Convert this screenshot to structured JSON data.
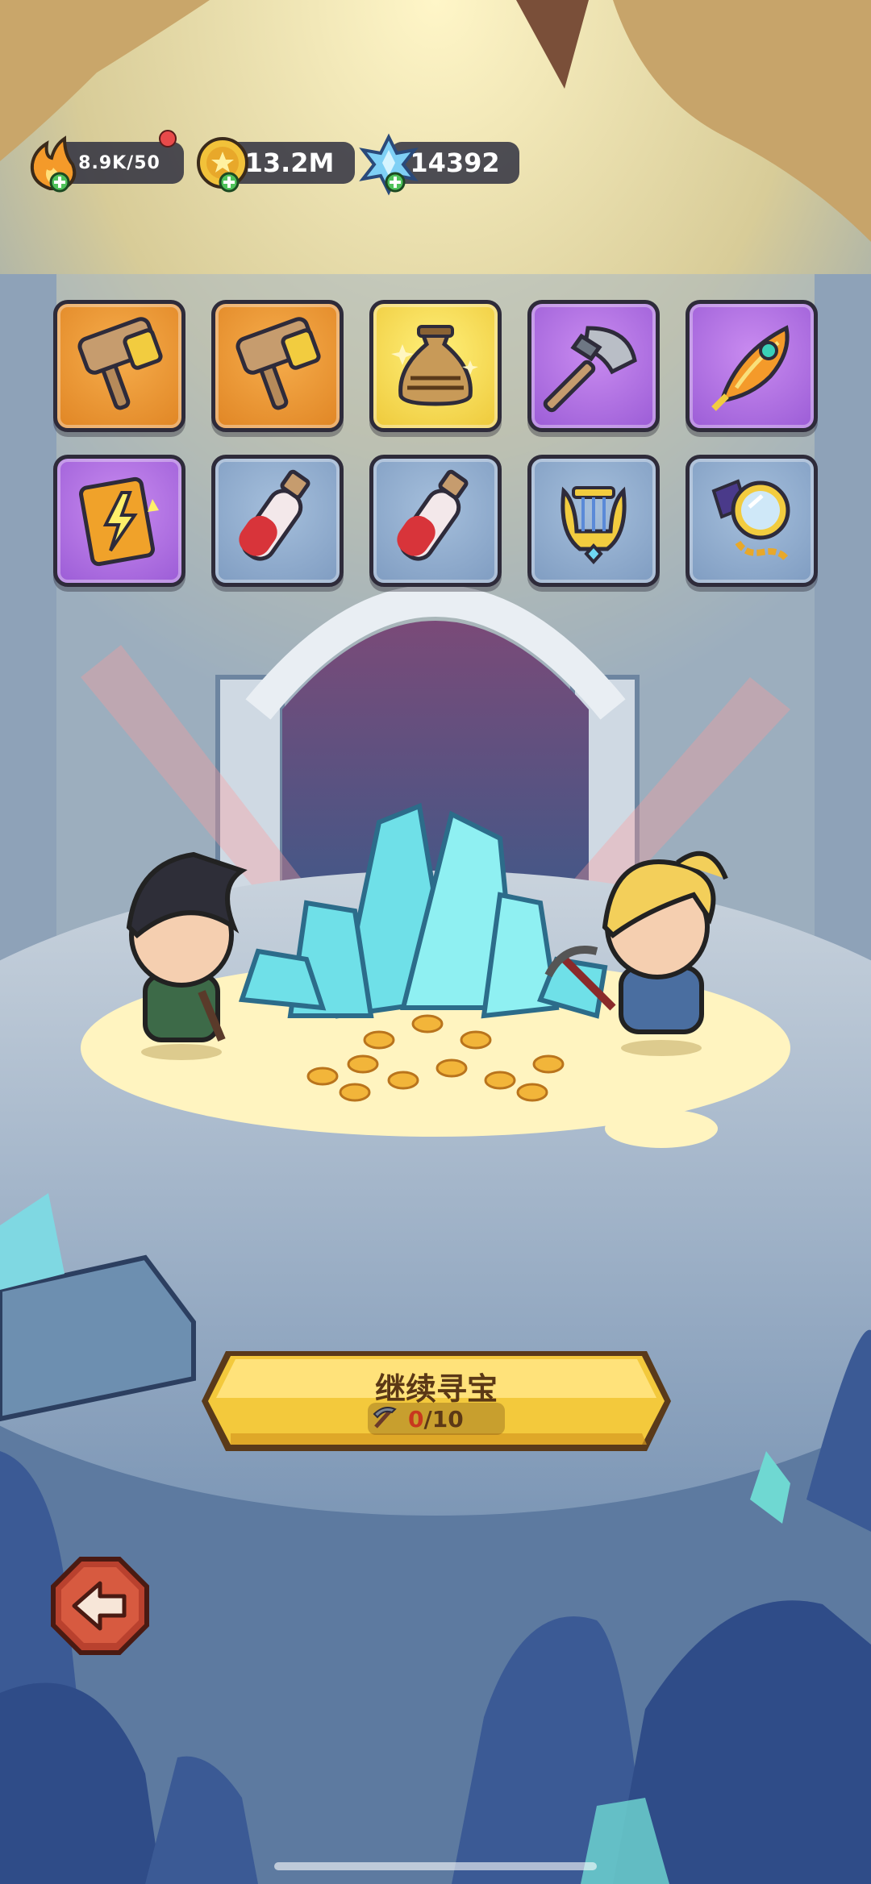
{
  "resources": {
    "energy": {
      "value": "8.9K/50",
      "icon": "flame-icon",
      "add_icon": "plus-icon"
    },
    "gold": {
      "value": "13.2M",
      "icon": "gold-coin-icon",
      "add_icon": "plus-icon"
    },
    "gems": {
      "value": "14392",
      "icon": "blue-crystal-icon",
      "add_icon": "plus-icon"
    }
  },
  "rewards": {
    "row1": [
      {
        "item": "war-hammer-icon",
        "rarity": "orange"
      },
      {
        "item": "war-hammer-icon",
        "rarity": "orange"
      },
      {
        "item": "sand-bag-icon",
        "rarity": "gold"
      },
      {
        "item": "battle-axe-icon",
        "rarity": "purple"
      },
      {
        "item": "fire-feather-icon",
        "rarity": "purple"
      }
    ],
    "row2": [
      {
        "item": "lightning-tome-icon",
        "rarity": "purple"
      },
      {
        "item": "red-potion-icon",
        "rarity": "blue"
      },
      {
        "item": "red-potion-icon",
        "rarity": "blue"
      },
      {
        "item": "golden-lyre-icon",
        "rarity": "blue"
      },
      {
        "item": "magic-mirror-icon",
        "rarity": "blue"
      }
    ],
    "rarity_colors": {
      "orange": "#e08524",
      "gold": "#eec93a",
      "purple": "#9b5cd6",
      "blue": "#7f9cc1"
    }
  },
  "action": {
    "continue_label": "继续寻宝",
    "progress_current": "0",
    "progress_rest": "/10",
    "icon": "pickaxe-icon"
  },
  "navigation": {
    "back_icon": "back-arrow-icon"
  }
}
